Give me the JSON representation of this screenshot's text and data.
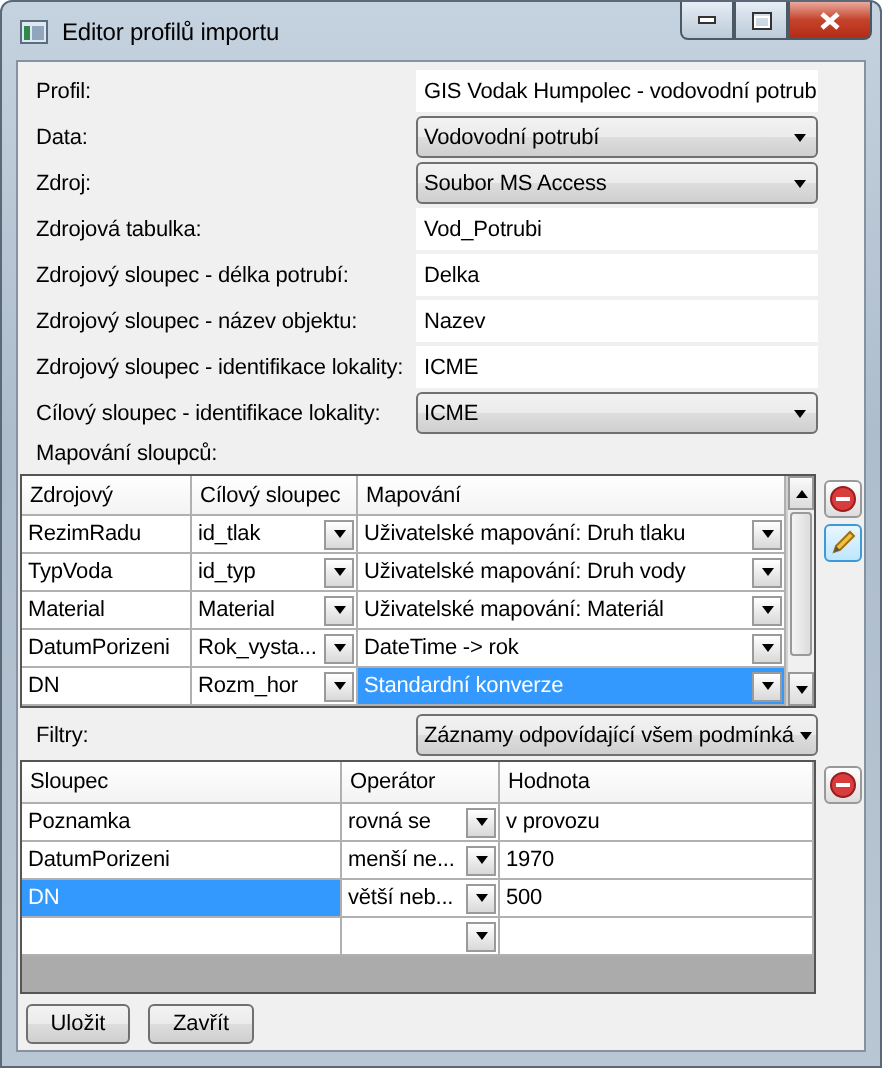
{
  "window": {
    "title": "Editor profilů importu"
  },
  "form": [
    {
      "label": "Profil:",
      "kind": "text",
      "value": "GIS Vodak Humpolec - vodovodní potrub"
    },
    {
      "label": "Data:",
      "kind": "dropdown",
      "value": "Vodovodní potrubí"
    },
    {
      "label": "Zdroj:",
      "kind": "dropdown",
      "value": "Soubor MS Access"
    },
    {
      "label": "Zdrojová tabulka:",
      "kind": "text",
      "value": "Vod_Potrubi"
    },
    {
      "label": "Zdrojový sloupec - délka potrubí:",
      "kind": "text",
      "value": "Delka"
    },
    {
      "label": "Zdrojový sloupec - název objektu:",
      "kind": "text",
      "value": "Nazev"
    },
    {
      "label": "Zdrojový sloupec - identifikace lokality:",
      "kind": "text",
      "value": "ICME"
    },
    {
      "label": "Cílový sloupec - identifikace lokality:",
      "kind": "dropdown",
      "value": "ICME"
    }
  ],
  "mapping": {
    "label": "Mapování sloupců:",
    "columns": [
      "Zdrojový",
      "Cílový sloupec",
      "Mapování"
    ],
    "rows": [
      {
        "source": "RezimRadu",
        "target": "id_tlak",
        "mapping": "Uživatelské mapování: Druh tlaku",
        "selected": false
      },
      {
        "source": "TypVoda",
        "target": "id_typ",
        "mapping": "Uživatelské mapování: Druh vody",
        "selected": false
      },
      {
        "source": "Material",
        "target": "Material",
        "mapping": "Uživatelské mapování: Materiál",
        "selected": false
      },
      {
        "source": "DatumPorizeni",
        "target": "Rok_vysta...",
        "mapping": "DateTime -> rok",
        "selected": false
      },
      {
        "source": "DN",
        "target": "Rozm_hor",
        "mapping": "Standardní konverze",
        "selected": true
      }
    ]
  },
  "filters": {
    "label": "Filtry:",
    "mode": "Záznamy odpovídající všem podmínká",
    "columns": [
      "Sloupec",
      "Operátor",
      "Hodnota"
    ],
    "rows": [
      {
        "column": "Poznamka",
        "operator": "rovná se",
        "value": "v provozu",
        "selected": false
      },
      {
        "column": "DatumPorizeni",
        "operator": "menší ne...",
        "value": "1970",
        "selected": false
      },
      {
        "column": "DN",
        "operator": "větší neb...",
        "value": "500",
        "selected": true
      }
    ],
    "new_row": true
  },
  "buttons": [
    "Uložit",
    "Zavřít"
  ]
}
